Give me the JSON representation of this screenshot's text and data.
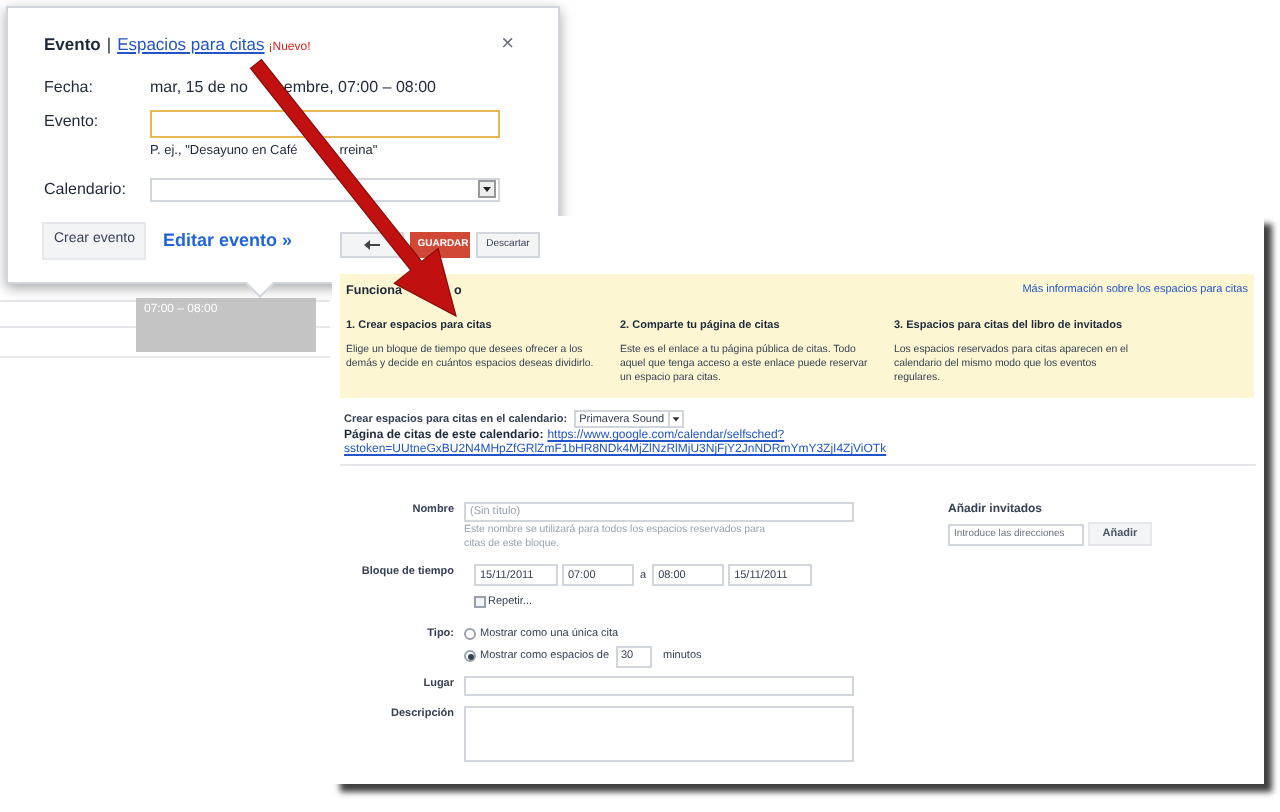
{
  "popup": {
    "title": "Evento",
    "separator": "|",
    "tab_link": "Espacios para citas",
    "badge": "¡Nuevo!",
    "close": "×",
    "date_label": "Fecha:",
    "date_value": [
      "mar, 15 de no",
      "embre, 07:00 – 08:00"
    ],
    "event_label": "Evento:",
    "event_hint": [
      "P. ej., \"Desayuno en Café",
      "rreina\""
    ],
    "calendar_label": "Calendario:",
    "create_button": "Crear evento",
    "edit_link": "Editar evento »"
  },
  "calendar_event": {
    "time": "07:00 – 08:00"
  },
  "panel": {
    "toolbar": {
      "save": "GUARDAR",
      "discard": "Descartar"
    },
    "how_it_works": {
      "title": [
        "Funciona",
        "o"
      ],
      "more_link": "Más información sobre los espacios para citas",
      "steps": [
        {
          "title": "1. Crear espacios para citas",
          "text": "Elige un bloque de tiempo que desees ofrecer a los demás y decide en cuántos espacios deseas dividirlo."
        },
        {
          "title": "2. Comparte tu página de citas",
          "text": "Este es el enlace a tu página pública de citas. Todo aquel que tenga acceso a este enlace puede reservar un espacio para citas."
        },
        {
          "title": "3. Espacios para citas del libro de invitados",
          "text": "Los espacios reservados para citas aparecen en el calendario del mismo modo que los eventos regulares."
        }
      ]
    },
    "calendar_select": {
      "label": "Crear espacios para citas en el calendario:",
      "value": "Primavera Sound"
    },
    "page_link": {
      "label": "Página de citas de este calendario:",
      "url_lines": [
        "https://www.google.com/calendar/selfsched?",
        "sstoken=UUtneGxBU2N4MHpZfGRlZmF1bHR8NDk4MjZlNzRlMjU3NjFjY2JnNDRmYmY3ZjI4ZjViOTk"
      ]
    },
    "form": {
      "name_label": "Nombre",
      "name_placeholder": "(Sin título)",
      "name_hint": "Este nombre se utilizará para todos los espacios reservados para citas de este bloque.",
      "time_label": "Bloque de tiempo",
      "start_date": "15/11/2011",
      "start_time": "07:00",
      "to": "a",
      "end_time": "08:00",
      "end_date": "15/11/2011",
      "repeat": {
        "label": "Repetir...",
        "checked": false
      },
      "type_label": "Tipo:",
      "type_options": [
        {
          "label": "Mostrar como una única cita",
          "selected": false
        },
        {
          "label": "Mostrar como espacios de",
          "selected": true
        }
      ],
      "slot_minutes": "30",
      "minutes_label": "minutos",
      "place_label": "Lugar",
      "description_label": "Descripción"
    },
    "guests": {
      "title": "Añadir invitados",
      "placeholder": "Introduce las direcciones",
      "button": "Añadir"
    }
  }
}
